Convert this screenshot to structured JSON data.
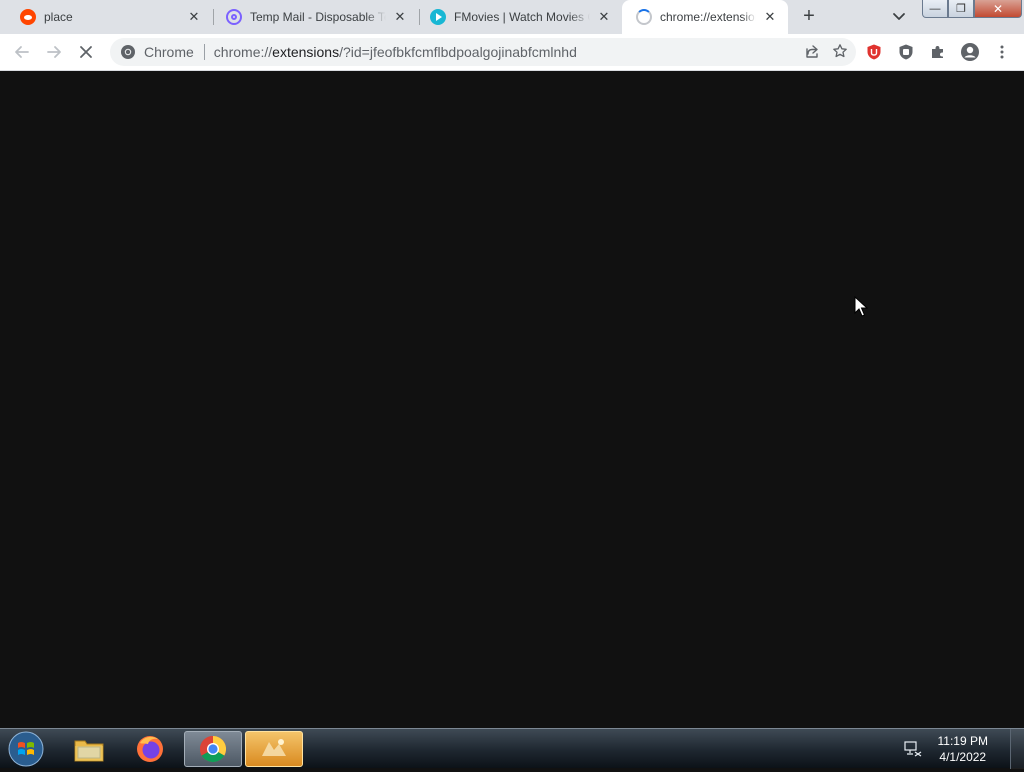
{
  "browser": {
    "tabs": [
      {
        "title": "place",
        "favicon": "reddit-icon",
        "active": false
      },
      {
        "title": "Temp Mail - Disposable Temporary Email",
        "favicon": "at-sign-icon",
        "active": false
      },
      {
        "title": "FMovies | Watch Movies Online Free",
        "favicon": "play-icon",
        "active": false
      },
      {
        "title": "chrome://extensions/?id=jfeofbkfcmflbdpoalgojinabfcmlnhd",
        "favicon": "loading-spinner-icon",
        "active": true
      }
    ],
    "new_tab_label": "+",
    "address_bar": {
      "site_label": "Chrome",
      "url_scheme": "chrome://",
      "url_host": "extensions",
      "url_rest": "/?id=jfeofbkfcmflbdpoalgojinabfcmlnhd"
    },
    "window_controls": {
      "minimize": "—",
      "maximize": "❐",
      "close": "✕"
    }
  },
  "taskbar": {
    "apps": [
      {
        "name": "windows-explorer",
        "icon": "folder-icon"
      },
      {
        "name": "firefox",
        "icon": "firefox-icon"
      },
      {
        "name": "chrome",
        "icon": "chrome-icon"
      },
      {
        "name": "unknown-app",
        "icon": "app-icon"
      }
    ],
    "clock_time": "11:19 PM",
    "clock_date": "4/1/2022"
  },
  "colors": {
    "page_background": "#111111",
    "tabstrip": "#dee1e6",
    "accent": "#1a73e8"
  }
}
